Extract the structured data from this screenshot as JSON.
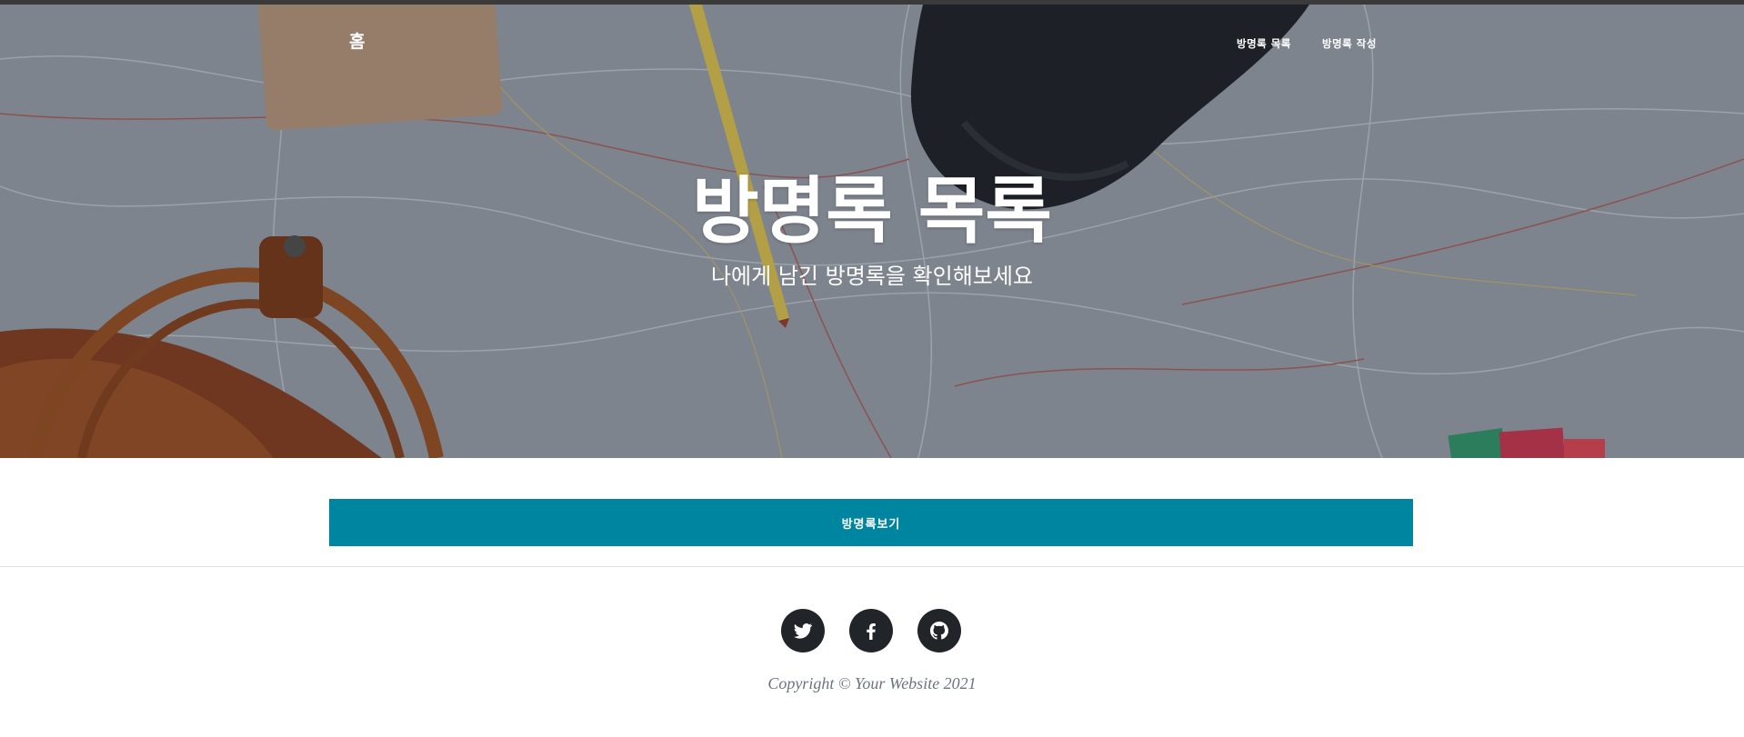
{
  "nav": {
    "brand": "홈",
    "links": [
      "방명록 목록",
      "방명록 작성"
    ]
  },
  "hero": {
    "title": "방명록 목록",
    "subtitle": "나에게 남긴 방명록을 확인해보세요"
  },
  "main": {
    "button_label": "방명록보기",
    "button_color": "#0085a1"
  },
  "footer": {
    "social_icons": [
      "twitter-icon",
      "facebook-icon",
      "github-icon"
    ],
    "copyright": "Copyright © Your Website 2021"
  }
}
